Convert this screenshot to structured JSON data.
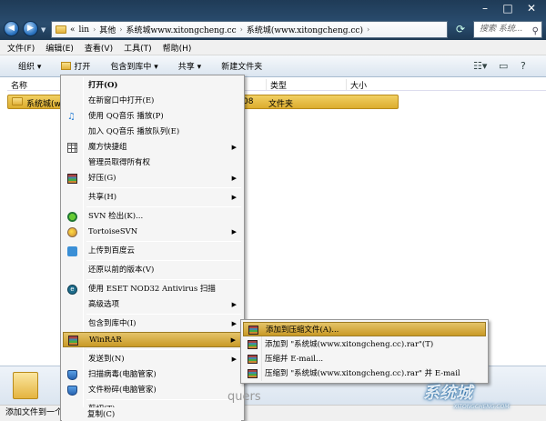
{
  "address": {
    "crumbs": [
      "«",
      "lin",
      "其他",
      "系统城www.xitongcheng.cc",
      "系统城(www.xitongcheng.cc)"
    ],
    "search_placeholder": "搜索 系统..."
  },
  "menubar": [
    "文件(F)",
    "编辑(E)",
    "查看(V)",
    "工具(T)",
    "帮助(H)"
  ],
  "cmdbar": {
    "organize": "组织 ▾",
    "open": "打开",
    "include": "包含到库中 ▾",
    "share": "共享 ▾",
    "newfolder": "新建文件夹"
  },
  "columns": {
    "name": "名称",
    "type": "类型",
    "size": "大小"
  },
  "file": {
    "name": "系统城(w",
    "date_tail": "08",
    "type": "文件夹"
  },
  "context_menu": {
    "open": "打开(O)",
    "open_new": "在新窗口中打开(E)",
    "qq_play": "使用 QQ音乐 播放(P)",
    "qq_add": "加入 QQ音乐 播放队列(E)",
    "magic": "魔方快捷组",
    "admin": "管理员取得所有权",
    "haozip": "好压(G)",
    "share": "共享(H)",
    "svn": "SVN 检出(K)...",
    "tsvn": "TortoiseSVN",
    "baidu": "上传到百度云",
    "restore": "还原以前的版本(V)",
    "eset": "使用 ESET NOD32 Antivirus 扫描",
    "advanced": "高级选项",
    "library": "包含到库中(I)",
    "winrar": "WinRAR",
    "sendto": "发送到(N)",
    "scan": "扫描病毒(电脑管家)",
    "shred": "文件粉碎(电脑管家)",
    "cut": "剪切(T)",
    "copy": "复制(C)"
  },
  "submenu": {
    "add_archive": "添加到压缩文件(A)...",
    "add_named": "添加到 \"系统城(www.xitongcheng.cc).rar\"(T)",
    "email": "压缩并 E-mail...",
    "email_named": "压缩到 \"系统城(www.xitongcheng.cc).rar\" 并 E-mail"
  },
  "details": {
    "line1": "系",
    "line2": "文"
  },
  "status": "添加文件到一个",
  "watermark": {
    "big": "系统城",
    "small": "XITONGCHENG.COM"
  },
  "watermark2": "quers"
}
